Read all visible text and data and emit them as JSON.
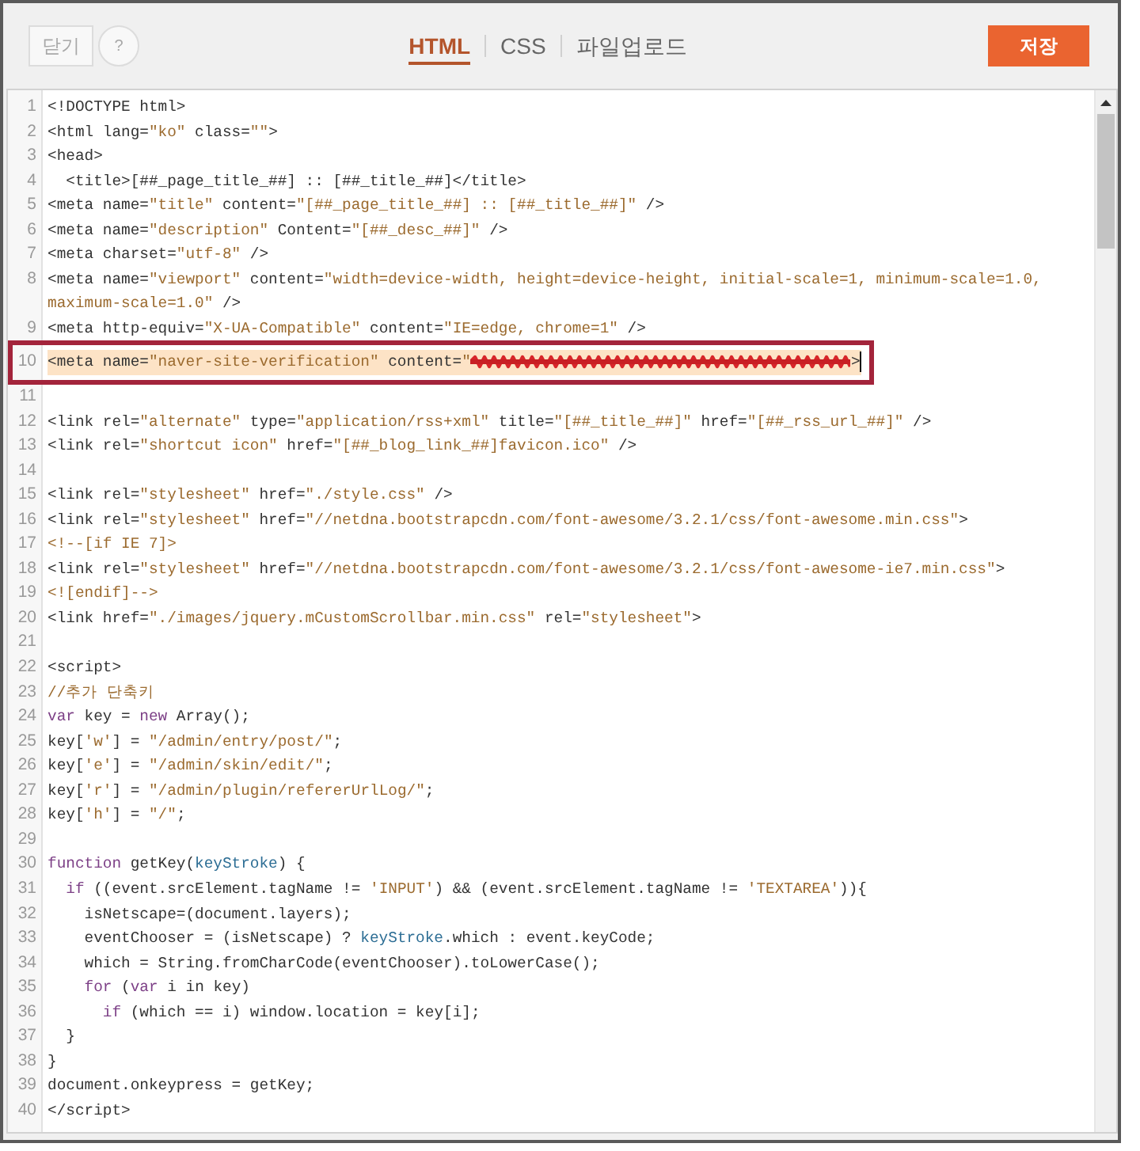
{
  "toolbar": {
    "close_button": "닫기",
    "help_button": "?",
    "tabs": [
      {
        "label": "HTML",
        "selected": true
      },
      {
        "label": "CSS",
        "selected": false
      },
      {
        "label": "파일업로드",
        "selected": false
      }
    ],
    "save_button": "저장"
  },
  "editor": {
    "lines": [
      {
        "number": "1",
        "highlighted": false,
        "boxed": false,
        "cursor": false,
        "segments": [
          {
            "text": "<!DOCTYPE html>",
            "kind": "plain"
          }
        ]
      },
      {
        "number": "2",
        "highlighted": false,
        "boxed": false,
        "cursor": false,
        "segments": [
          {
            "text": "<html lang=",
            "kind": "plain"
          },
          {
            "text": "\"ko\"",
            "kind": "string"
          },
          {
            "text": " class=",
            "kind": "plain"
          },
          {
            "text": "\"\"",
            "kind": "string"
          },
          {
            "text": ">",
            "kind": "plain"
          }
        ]
      },
      {
        "number": "3",
        "highlighted": false,
        "boxed": false,
        "cursor": false,
        "segments": [
          {
            "text": "<head>",
            "kind": "plain"
          }
        ]
      },
      {
        "number": "4",
        "highlighted": false,
        "boxed": false,
        "cursor": false,
        "segments": [
          {
            "text": "  <title>[##_page_title_##] :: [##_title_##]</title>",
            "kind": "plain"
          }
        ]
      },
      {
        "number": "5",
        "highlighted": false,
        "boxed": false,
        "cursor": false,
        "segments": [
          {
            "text": "<meta name=",
            "kind": "plain"
          },
          {
            "text": "\"title\"",
            "kind": "string"
          },
          {
            "text": " content=",
            "kind": "plain"
          },
          {
            "text": "\"[##_page_title_##] :: [##_title_##]\"",
            "kind": "string"
          },
          {
            "text": " />",
            "kind": "plain"
          }
        ]
      },
      {
        "number": "6",
        "highlighted": false,
        "boxed": false,
        "cursor": false,
        "segments": [
          {
            "text": "<meta name=",
            "kind": "plain"
          },
          {
            "text": "\"description\"",
            "kind": "string"
          },
          {
            "text": " Content=",
            "kind": "plain"
          },
          {
            "text": "\"[##_desc_##]\"",
            "kind": "string"
          },
          {
            "text": " />",
            "kind": "plain"
          }
        ]
      },
      {
        "number": "7",
        "highlighted": false,
        "boxed": false,
        "cursor": false,
        "segments": [
          {
            "text": "<meta charset=",
            "kind": "plain"
          },
          {
            "text": "\"utf-8\"",
            "kind": "string"
          },
          {
            "text": " />",
            "kind": "plain"
          }
        ]
      },
      {
        "number": "8",
        "highlighted": false,
        "boxed": false,
        "cursor": false,
        "segments": [
          {
            "text": "<meta name=",
            "kind": "plain"
          },
          {
            "text": "\"viewport\"",
            "kind": "string"
          },
          {
            "text": " content=",
            "kind": "plain"
          },
          {
            "text": "\"width=device-width, height=device-height, initial-scale=1, minimum-scale=1.0, maximum-scale=1.0\"",
            "kind": "string"
          },
          {
            "text": " />",
            "kind": "plain"
          }
        ]
      },
      {
        "number": "9",
        "highlighted": false,
        "boxed": false,
        "cursor": false,
        "segments": [
          {
            "text": "<meta http-equiv=",
            "kind": "plain"
          },
          {
            "text": "\"X-UA-Compatible\"",
            "kind": "string"
          },
          {
            "text": " content=",
            "kind": "plain"
          },
          {
            "text": "\"IE=edge, chrome=1\"",
            "kind": "string"
          },
          {
            "text": " />",
            "kind": "plain"
          }
        ]
      },
      {
        "number": "10",
        "highlighted": true,
        "boxed": true,
        "cursor": true,
        "segments": [
          {
            "text": "<meta name=",
            "kind": "plain"
          },
          {
            "text": "\"naver-site-verification\"",
            "kind": "string"
          },
          {
            "text": " content=",
            "kind": "plain"
          },
          {
            "text": "\"",
            "kind": "string"
          },
          {
            "kind": "redaction"
          },
          {
            "text": ">",
            "kind": "plain"
          }
        ]
      },
      {
        "number": "11",
        "highlighted": false,
        "boxed": false,
        "cursor": false
      },
      {
        "number": "12",
        "highlighted": false,
        "boxed": false,
        "cursor": false,
        "segments": [
          {
            "text": "<link rel=",
            "kind": "plain"
          },
          {
            "text": "\"alternate\"",
            "kind": "string"
          },
          {
            "text": " type=",
            "kind": "plain"
          },
          {
            "text": "\"application/rss+xml\"",
            "kind": "string"
          },
          {
            "text": " title=",
            "kind": "plain"
          },
          {
            "text": "\"[##_title_##]\"",
            "kind": "string"
          },
          {
            "text": " href=",
            "kind": "plain"
          },
          {
            "text": "\"[##_rss_url_##]\"",
            "kind": "string"
          },
          {
            "text": " />",
            "kind": "plain"
          }
        ]
      },
      {
        "number": "13",
        "highlighted": false,
        "boxed": false,
        "cursor": false,
        "segments": [
          {
            "text": "<link rel=",
            "kind": "plain"
          },
          {
            "text": "\"shortcut icon\"",
            "kind": "string"
          },
          {
            "text": " href=",
            "kind": "plain"
          },
          {
            "text": "\"[##_blog_link_##]favicon.ico\"",
            "kind": "string"
          },
          {
            "text": " />",
            "kind": "plain"
          }
        ]
      },
      {
        "number": "14",
        "highlighted": false,
        "boxed": false,
        "cursor": false
      },
      {
        "number": "15",
        "highlighted": false,
        "boxed": false,
        "cursor": false,
        "segments": [
          {
            "text": "<link rel=",
            "kind": "plain"
          },
          {
            "text": "\"stylesheet\"",
            "kind": "string"
          },
          {
            "text": " href=",
            "kind": "plain"
          },
          {
            "text": "\"./style.css\"",
            "kind": "string"
          },
          {
            "text": " />",
            "kind": "plain"
          }
        ]
      },
      {
        "number": "16",
        "highlighted": false,
        "boxed": false,
        "cursor": false,
        "segments": [
          {
            "text": "<link rel=",
            "kind": "plain"
          },
          {
            "text": "\"stylesheet\"",
            "kind": "string"
          },
          {
            "text": " href=",
            "kind": "plain"
          },
          {
            "text": "\"//netdna.bootstrapcdn.com/font-awesome/3.2.1/css/font-awesome.min.css\"",
            "kind": "string"
          },
          {
            "text": ">",
            "kind": "plain"
          }
        ]
      },
      {
        "number": "17",
        "highlighted": false,
        "boxed": false,
        "cursor": false,
        "segments": [
          {
            "text": "<!--[if IE 7]>",
            "kind": "comment"
          }
        ]
      },
      {
        "number": "18",
        "highlighted": false,
        "boxed": false,
        "cursor": false,
        "segments": [
          {
            "text": "<link rel=",
            "kind": "plain"
          },
          {
            "text": "\"stylesheet\"",
            "kind": "string"
          },
          {
            "text": " href=",
            "kind": "plain"
          },
          {
            "text": "\"//netdna.bootstrapcdn.com/font-awesome/3.2.1/css/font-awesome-ie7.min.css\"",
            "kind": "string"
          },
          {
            "text": ">",
            "kind": "plain"
          }
        ]
      },
      {
        "number": "19",
        "highlighted": false,
        "boxed": false,
        "cursor": false,
        "segments": [
          {
            "text": "<![endif]-->",
            "kind": "comment"
          }
        ]
      },
      {
        "number": "20",
        "highlighted": false,
        "boxed": false,
        "cursor": false,
        "segments": [
          {
            "text": "<link href=",
            "kind": "plain"
          },
          {
            "text": "\"./images/jquery.mCustomScrollbar.min.css\"",
            "kind": "string"
          },
          {
            "text": " rel=",
            "kind": "plain"
          },
          {
            "text": "\"stylesheet\"",
            "kind": "string"
          },
          {
            "text": ">",
            "kind": "plain"
          }
        ]
      },
      {
        "number": "21",
        "highlighted": false,
        "boxed": false,
        "cursor": false
      },
      {
        "number": "22",
        "highlighted": false,
        "boxed": false,
        "cursor": false,
        "segments": [
          {
            "text": "<script>",
            "kind": "plain"
          }
        ]
      },
      {
        "number": "23",
        "highlighted": false,
        "boxed": false,
        "cursor": false,
        "segments": [
          {
            "text": "//추가 단축키",
            "kind": "comment"
          }
        ]
      },
      {
        "number": "24",
        "highlighted": false,
        "boxed": false,
        "cursor": false,
        "segments": [
          {
            "text": "var",
            "kind": "keyword"
          },
          {
            "text": " key = ",
            "kind": "plain"
          },
          {
            "text": "new",
            "kind": "keyword"
          },
          {
            "text": " Array();",
            "kind": "plain"
          }
        ]
      },
      {
        "number": "25",
        "highlighted": false,
        "boxed": false,
        "cursor": false,
        "segments": [
          {
            "text": "key[",
            "kind": "plain"
          },
          {
            "text": "'w'",
            "kind": "string"
          },
          {
            "text": "] = ",
            "kind": "plain"
          },
          {
            "text": "\"/admin/entry/post/\"",
            "kind": "string"
          },
          {
            "text": ";",
            "kind": "plain"
          }
        ]
      },
      {
        "number": "26",
        "highlighted": false,
        "boxed": false,
        "cursor": false,
        "segments": [
          {
            "text": "key[",
            "kind": "plain"
          },
          {
            "text": "'e'",
            "kind": "string"
          },
          {
            "text": "] = ",
            "kind": "plain"
          },
          {
            "text": "\"/admin/skin/edit/\"",
            "kind": "string"
          },
          {
            "text": ";",
            "kind": "plain"
          }
        ]
      },
      {
        "number": "27",
        "highlighted": false,
        "boxed": false,
        "cursor": false,
        "segments": [
          {
            "text": "key[",
            "kind": "plain"
          },
          {
            "text": "'r'",
            "kind": "string"
          },
          {
            "text": "] = ",
            "kind": "plain"
          },
          {
            "text": "\"/admin/plugin/refererUrlLog/\"",
            "kind": "string"
          },
          {
            "text": ";",
            "kind": "plain"
          }
        ]
      },
      {
        "number": "28",
        "highlighted": false,
        "boxed": false,
        "cursor": false,
        "segments": [
          {
            "text": "key[",
            "kind": "plain"
          },
          {
            "text": "'h'",
            "kind": "string"
          },
          {
            "text": "] = ",
            "kind": "plain"
          },
          {
            "text": "\"/\"",
            "kind": "string"
          },
          {
            "text": ";",
            "kind": "plain"
          }
        ]
      },
      {
        "number": "29",
        "highlighted": false,
        "boxed": false,
        "cursor": false
      },
      {
        "number": "30",
        "highlighted": false,
        "boxed": false,
        "cursor": false,
        "segments": [
          {
            "text": "function",
            "kind": "keyword"
          },
          {
            "text": " getKey(",
            "kind": "plain"
          },
          {
            "text": "keyStroke",
            "kind": "variable"
          },
          {
            "text": ") {",
            "kind": "plain"
          }
        ]
      },
      {
        "number": "31",
        "highlighted": false,
        "boxed": false,
        "cursor": false,
        "segments": [
          {
            "text": "  if",
            "kind": "keyword"
          },
          {
            "text": " ((event.srcElement.tagName != ",
            "kind": "plain"
          },
          {
            "text": "'INPUT'",
            "kind": "string"
          },
          {
            "text": ") && (event.srcElement.tagName != ",
            "kind": "plain"
          },
          {
            "text": "'TEXTAREA'",
            "kind": "string"
          },
          {
            "text": ")){",
            "kind": "plain"
          }
        ]
      },
      {
        "number": "32",
        "highlighted": false,
        "boxed": false,
        "cursor": false,
        "segments": [
          {
            "text": "    isNetscape=(document.layers);",
            "kind": "plain"
          }
        ]
      },
      {
        "number": "33",
        "highlighted": false,
        "boxed": false,
        "cursor": false,
        "segments": [
          {
            "text": "    eventChooser = (isNetscape) ? ",
            "kind": "plain"
          },
          {
            "text": "keyStroke",
            "kind": "variable"
          },
          {
            "text": ".which : event.keyCode;",
            "kind": "plain"
          }
        ]
      },
      {
        "number": "34",
        "highlighted": false,
        "boxed": false,
        "cursor": false,
        "segments": [
          {
            "text": "    which = String.fromCharCode(eventChooser).toLowerCase();",
            "kind": "plain"
          }
        ]
      },
      {
        "number": "35",
        "highlighted": false,
        "boxed": false,
        "cursor": false,
        "segments": [
          {
            "text": "    for",
            "kind": "keyword"
          },
          {
            "text": " (",
            "kind": "plain"
          },
          {
            "text": "var",
            "kind": "keyword"
          },
          {
            "text": " i in key)",
            "kind": "plain"
          }
        ]
      },
      {
        "number": "36",
        "highlighted": false,
        "boxed": false,
        "cursor": false,
        "segments": [
          {
            "text": "      if",
            "kind": "keyword"
          },
          {
            "text": " (which == i) window.location = key[i];",
            "kind": "plain"
          }
        ]
      },
      {
        "number": "37",
        "highlighted": false,
        "boxed": false,
        "cursor": false,
        "segments": [
          {
            "text": "  }",
            "kind": "plain"
          }
        ]
      },
      {
        "number": "38",
        "highlighted": false,
        "boxed": false,
        "cursor": false,
        "segments": [
          {
            "text": "}",
            "kind": "plain"
          }
        ]
      },
      {
        "number": "39",
        "highlighted": false,
        "boxed": false,
        "cursor": false,
        "segments": [
          {
            "text": "document.onkeypress = getKey;",
            "kind": "plain"
          }
        ]
      },
      {
        "number": "40",
        "highlighted": false,
        "boxed": false,
        "cursor": false,
        "segments": [
          {
            "text": "</script>",
            "kind": "plain"
          }
        ]
      }
    ]
  }
}
